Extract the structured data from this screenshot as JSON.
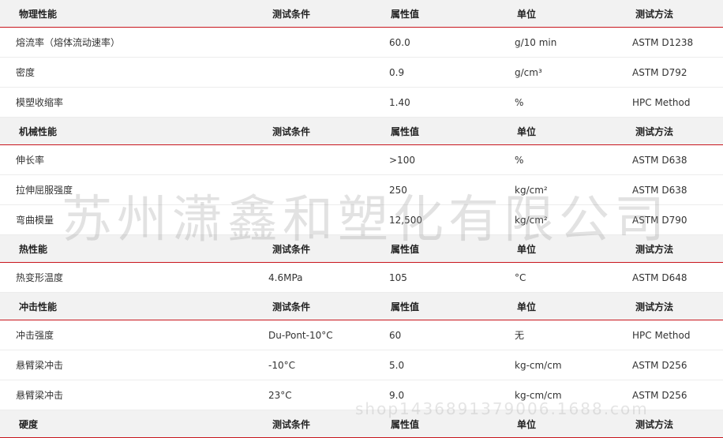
{
  "watermark": "苏州潇鑫和塑化有限公司",
  "watermark_url": "shop1436891379006.1688.com",
  "columns": [
    "测试条件",
    "属性值",
    "单位",
    "测试方法"
  ],
  "sections": [
    {
      "title": "物理性能",
      "rows": [
        [
          "熔流率（熔体流动速率）",
          "",
          "60.0",
          "g/10 min",
          "ASTM D1238"
        ],
        [
          "密度",
          "",
          "0.9",
          "g/cm³",
          "ASTM D792"
        ],
        [
          "模塑收缩率",
          "",
          "1.40",
          "%",
          "HPC Method"
        ]
      ]
    },
    {
      "title": "机械性能",
      "rows": [
        [
          "伸长率",
          "",
          ">100",
          "%",
          "ASTM D638"
        ],
        [
          "拉伸屈服强度",
          "",
          "250",
          "kg/cm²",
          "ASTM D638"
        ],
        [
          "弯曲模量",
          "",
          "12,500",
          "kg/cm²",
          "ASTM D790"
        ]
      ]
    },
    {
      "title": "热性能",
      "rows": [
        [
          "热变形温度",
          "4.6MPa",
          "105",
          "°C",
          "ASTM D648"
        ]
      ]
    },
    {
      "title": "冲击性能",
      "rows": [
        [
          "冲击强度",
          "Du-Pont-10°C",
          "60",
          "无",
          "HPC Method"
        ],
        [
          "悬臂梁冲击",
          "-10°C",
          "5.0",
          "kg-cm/cm",
          "ASTM D256"
        ],
        [
          "悬臂梁冲击",
          "23°C",
          "9.0",
          "kg-cm/cm",
          "ASTM D256"
        ]
      ]
    },
    {
      "title": "硬度",
      "rows": []
    }
  ]
}
